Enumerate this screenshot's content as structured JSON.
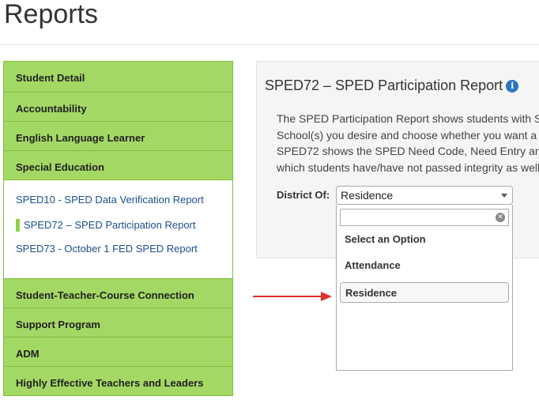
{
  "page": {
    "title": "Reports"
  },
  "sidebar": {
    "items_before": [
      {
        "label": "Student Detail"
      },
      {
        "label": "Accountability"
      },
      {
        "label": "English Language Learner"
      },
      {
        "label": "Special Education"
      }
    ],
    "sublinks": [
      {
        "label": "SPED10 - SPED Data Verification Report",
        "active": false
      },
      {
        "label": "SPED72 – SPED Participation Report",
        "active": true
      },
      {
        "label": "SPED73 - October 1 FED SPED Report",
        "active": false
      }
    ],
    "items_after": [
      {
        "label": "Student-Teacher-Course Connection"
      },
      {
        "label": "Support Program"
      },
      {
        "label": "ADM"
      },
      {
        "label": "Highly Effective Teachers and Leaders"
      }
    ]
  },
  "report": {
    "title": "SPED72 – SPED Participation Report",
    "info_icon": "info-icon",
    "description_lines": [
      "The SPED Participation Report shows students with S",
      "School(s) you desire and choose whether you want a",
      "SPED72 shows the SPED Need Code, Need Entry an",
      "which students have/have not passed integrity as well"
    ]
  },
  "district_select": {
    "label": "District Of:",
    "selected": "Residence",
    "search_value": "",
    "options": [
      {
        "label": "Select an Option",
        "highlighted": false
      },
      {
        "label": "Attendance",
        "highlighted": false
      },
      {
        "label": "Residence",
        "highlighted": true
      }
    ]
  },
  "colors": {
    "sidebar_bg": "#a3d865",
    "sidebar_border": "#7fbf3a",
    "link": "#1f4e8c",
    "arrow": "#e03030",
    "info": "#2f74c0"
  }
}
